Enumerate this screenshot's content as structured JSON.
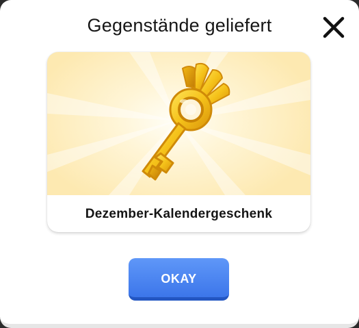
{
  "dialog": {
    "title": "Gegenstände geliefert",
    "close_icon": "close-icon"
  },
  "reward": {
    "icon": "golden-key-icon",
    "label": "Dezember-Kalendergeschenk"
  },
  "actions": {
    "okay_label": "OKAY"
  },
  "colors": {
    "accent": "#4a84f2",
    "card_background": "#fdebb8",
    "key_gold": "#f6c418"
  }
}
